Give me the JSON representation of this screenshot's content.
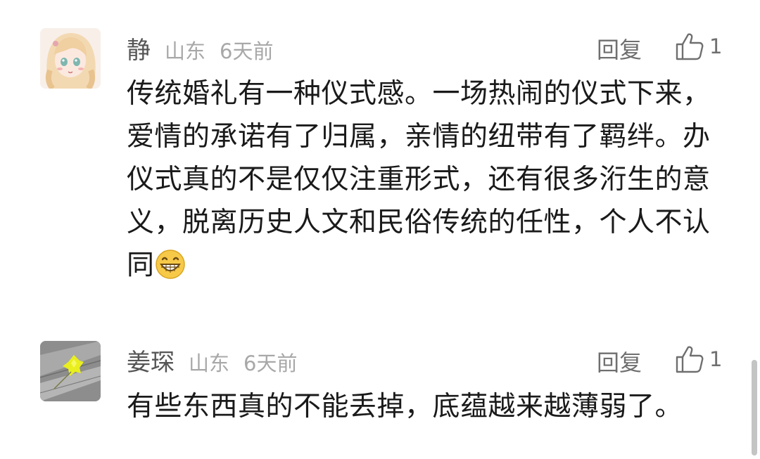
{
  "comments": [
    {
      "user": "静",
      "location": "山东",
      "time": "6天前",
      "reply_label": "回复",
      "like_count": "1",
      "text": "传统婚礼有一种仪式感。一场热闹的仪式下来，爱情的承诺有了归属，亲情的纽带有了羁绊。办仪式真的不是仅仅注重形式，还有很多洐生的意义，脱离历史人文和民俗传统的任性，个人不认同",
      "emoji": "grinning-face-icon"
    },
    {
      "user": "姜琛",
      "location": "山东",
      "time": "6天前",
      "reply_label": "回复",
      "like_count": "1",
      "text": "有些东西真的不能丢掉，底蕴越来越薄弱了。"
    }
  ],
  "colors": {
    "username": "#555555",
    "meta": "#a8a8a8",
    "action": "#6f6f6f",
    "body": "#1a1a1a",
    "emoji_face": "#f7c948"
  }
}
